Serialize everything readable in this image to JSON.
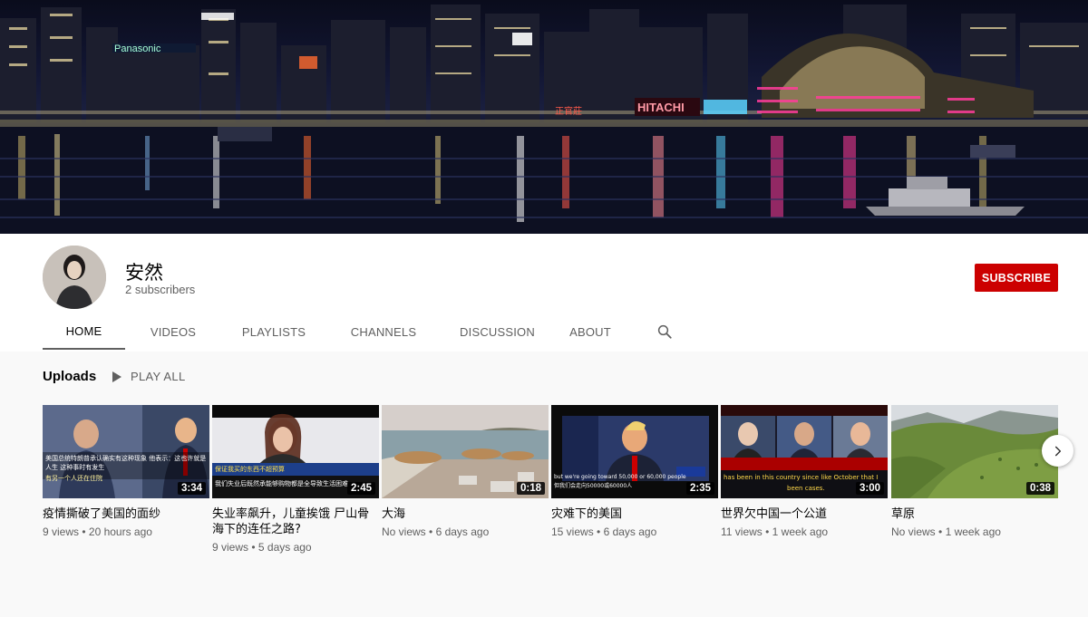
{
  "channel": {
    "name": "安然",
    "subscribers": "2 subscribers",
    "subscribe_label": "SUBSCRIBE"
  },
  "banner": {
    "signs": [
      "Panasonic",
      "HITACHI",
      "正官莊"
    ]
  },
  "tabs": [
    {
      "label": "HOME",
      "active": true
    },
    {
      "label": "VIDEOS",
      "active": false
    },
    {
      "label": "PLAYLISTS",
      "active": false
    },
    {
      "label": "CHANNELS",
      "active": false
    },
    {
      "label": "DISCUSSION",
      "active": false
    },
    {
      "label": "ABOUT",
      "active": false
    }
  ],
  "uploads": {
    "title": "Uploads",
    "play_all": "PLAY ALL",
    "videos": [
      {
        "title": "疫情撕破了美国的面纱",
        "views": "9 views",
        "age": "20 hours ago",
        "duration": "3:34",
        "caption": "美国总统特朗普承认确实有这种现象 他表示：这也许就是人生 这种事时有发生",
        "caption2": "有另一个人还在住院"
      },
      {
        "title": "失业率飙升，儿童挨饿 尸山骨海下的连任之路?",
        "views": "9 views",
        "age": "5 days ago",
        "duration": "2:45",
        "caption": "保证我买的东西不超预算",
        "caption2": "我们失业后既然承能够购物都是全导致生活困难"
      },
      {
        "title": "大海",
        "views": "No views",
        "age": "6 days ago",
        "duration": "0:18"
      },
      {
        "title": "灾难下的美国",
        "views": "15 views",
        "age": "6 days ago",
        "duration": "2:35",
        "caption": "but we're going toward 50,000 or 60,000 people",
        "caption2": "但我们会走向50000或60000人"
      },
      {
        "title": "世界欠中国一个公道",
        "views": "11 views",
        "age": "1 week ago",
        "duration": "3:00",
        "caption": "has been in this country since like October that I",
        "caption2": "been cases."
      },
      {
        "title": "草原",
        "views": "No views",
        "age": "1 week ago",
        "duration": "0:38"
      }
    ]
  },
  "icons": {
    "search": "search-icon",
    "play": "play-icon",
    "next": "chevron-right-icon"
  },
  "colors": {
    "subscribe": "#cc0000",
    "text_secondary": "#606060"
  }
}
